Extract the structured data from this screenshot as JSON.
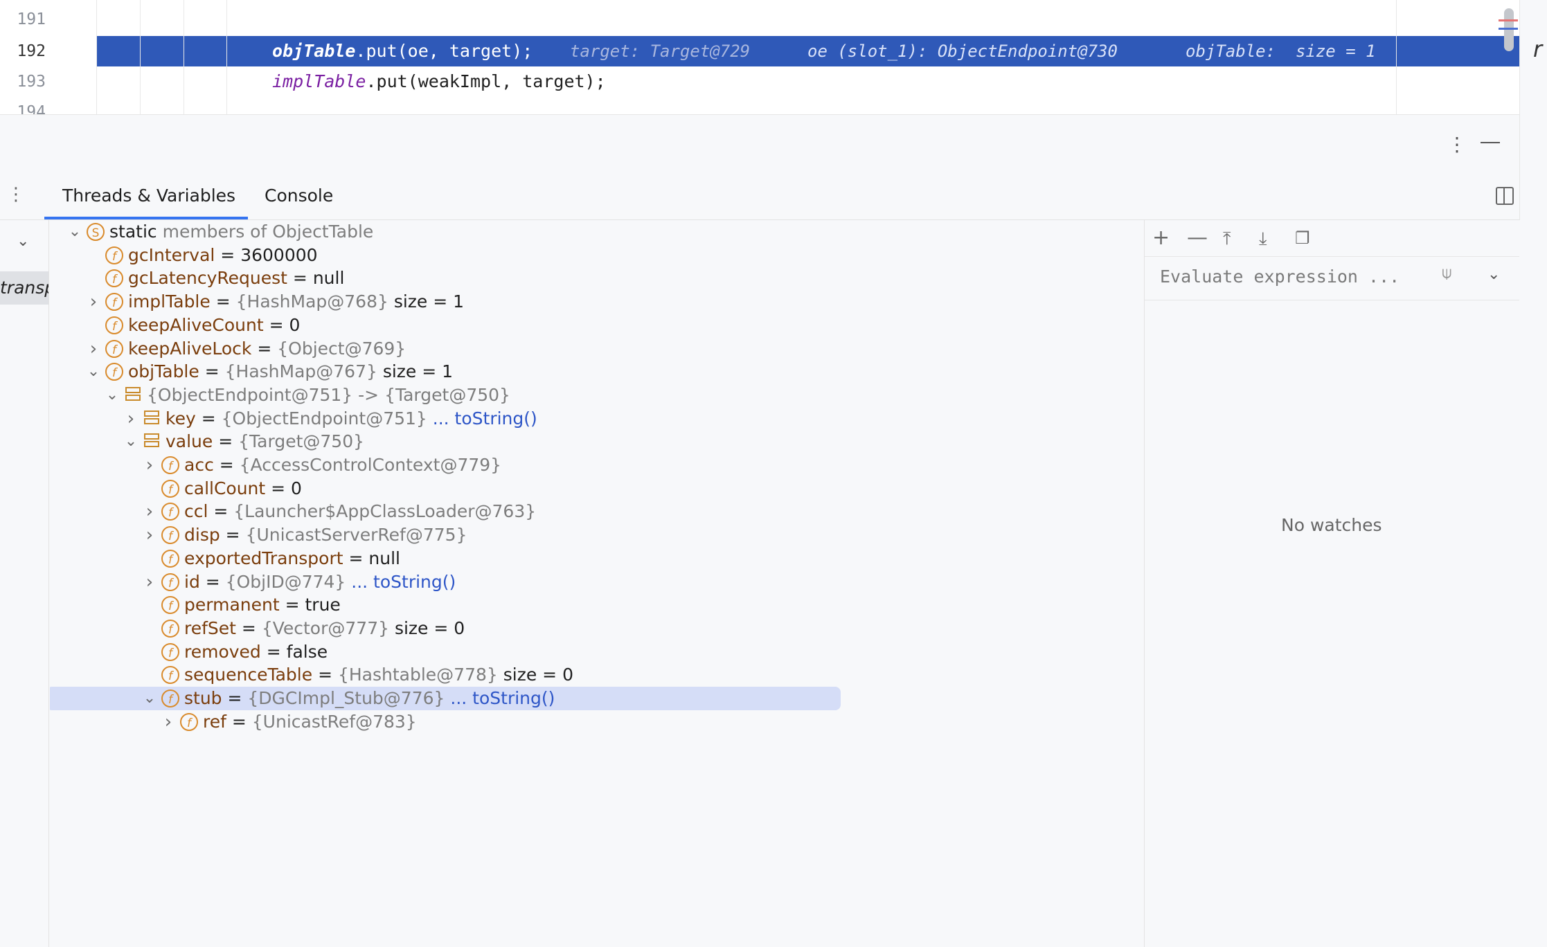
{
  "editor": {
    "lines": [
      {
        "num": "191",
        "code": ""
      },
      {
        "num": "192",
        "var": "objTable",
        "code": ".put(oe, target);",
        "inlays": [
          {
            "label": "target:",
            "value": "Target@729"
          },
          {
            "label": "oe (slot_1):",
            "value": "ObjectEndpoint@730"
          },
          {
            "label": "objTable:",
            "value": "size = 1"
          }
        ]
      },
      {
        "num": "193",
        "var": "implTable",
        "code": ".put(weakImpl, target);"
      },
      {
        "num": "194",
        "code": ""
      }
    ]
  },
  "tabs": [
    {
      "label": "Threads & Variables",
      "active": true
    },
    {
      "label": "Console",
      "active": false
    }
  ],
  "left_rail": {
    "frame_label": "transp"
  },
  "tree": [
    {
      "indent": 0,
      "expander": "down",
      "icon": "S",
      "plain": "static",
      "ref": "members of ObjectTable"
    },
    {
      "indent": 1,
      "expander": "",
      "icon": "f",
      "name": "gcInterval",
      "value": "3600000"
    },
    {
      "indent": 1,
      "expander": "",
      "icon": "f",
      "name": "gcLatencyRequest",
      "value": "null"
    },
    {
      "indent": 1,
      "expander": "right",
      "icon": "f",
      "name": "implTable",
      "ref": "{HashMap@768}",
      "size": "size = 1"
    },
    {
      "indent": 1,
      "expander": "",
      "icon": "f",
      "name": "keepAliveCount",
      "value": "0"
    },
    {
      "indent": 1,
      "expander": "right",
      "icon": "f",
      "name": "keepAliveLock",
      "ref": "{Object@769}"
    },
    {
      "indent": 1,
      "expander": "down",
      "icon": "f",
      "name": "objTable",
      "ref": "{HashMap@767}",
      "size": "size = 1"
    },
    {
      "indent": 2,
      "expander": "down",
      "icon": "entry",
      "ref": "{ObjectEndpoint@751}  -> {Target@750}"
    },
    {
      "indent": 3,
      "expander": "right",
      "icon": "entry",
      "name": "key",
      "ref": "{ObjectEndpoint@751}",
      "link": "... toString()"
    },
    {
      "indent": 3,
      "expander": "down",
      "icon": "entry",
      "name": "value",
      "ref": "{Target@750}"
    },
    {
      "indent": 4,
      "expander": "right",
      "icon": "f",
      "name": "acc",
      "ref": "{AccessControlContext@779}"
    },
    {
      "indent": 4,
      "expander": "",
      "icon": "f",
      "name": "callCount",
      "value": "0"
    },
    {
      "indent": 4,
      "expander": "right",
      "icon": "f",
      "name": "ccl",
      "ref": "{Launcher$AppClassLoader@763}"
    },
    {
      "indent": 4,
      "expander": "right",
      "icon": "f",
      "name": "disp",
      "ref": "{UnicastServerRef@775}"
    },
    {
      "indent": 4,
      "expander": "",
      "icon": "f",
      "name": "exportedTransport",
      "value": "null"
    },
    {
      "indent": 4,
      "expander": "right",
      "icon": "f",
      "name": "id",
      "ref": "{ObjID@774}",
      "link": "... toString()"
    },
    {
      "indent": 4,
      "expander": "",
      "icon": "f",
      "name": "permanent",
      "value": "true"
    },
    {
      "indent": 4,
      "expander": "",
      "icon": "f",
      "name": "refSet",
      "ref": "{Vector@777}",
      "size": "size = 0"
    },
    {
      "indent": 4,
      "expander": "",
      "icon": "f",
      "name": "removed",
      "value": "false"
    },
    {
      "indent": 4,
      "expander": "",
      "icon": "f",
      "name": "sequenceTable",
      "ref": "{Hashtable@778}",
      "size": "size = 0"
    },
    {
      "indent": 4,
      "expander": "down",
      "icon": "f",
      "name": "stub",
      "ref": "{DGCImpl_Stub@776}",
      "link": "... toString()",
      "selected": true
    },
    {
      "indent": 5,
      "expander": "right",
      "icon": "f",
      "name": "ref",
      "ref": "{UnicastRef@783}"
    }
  ],
  "watches": {
    "placeholder": "Evaluate expression ...",
    "empty_text": "No watches",
    "toolbar": [
      "add-icon",
      "remove-icon",
      "move-up-icon",
      "move-down-icon",
      "duplicate-icon"
    ]
  },
  "colors": {
    "accent": "#3574f0",
    "highlight_line": "#2f59b8",
    "selection": "#d5ddf7",
    "field_icon": "#d98a2b"
  }
}
